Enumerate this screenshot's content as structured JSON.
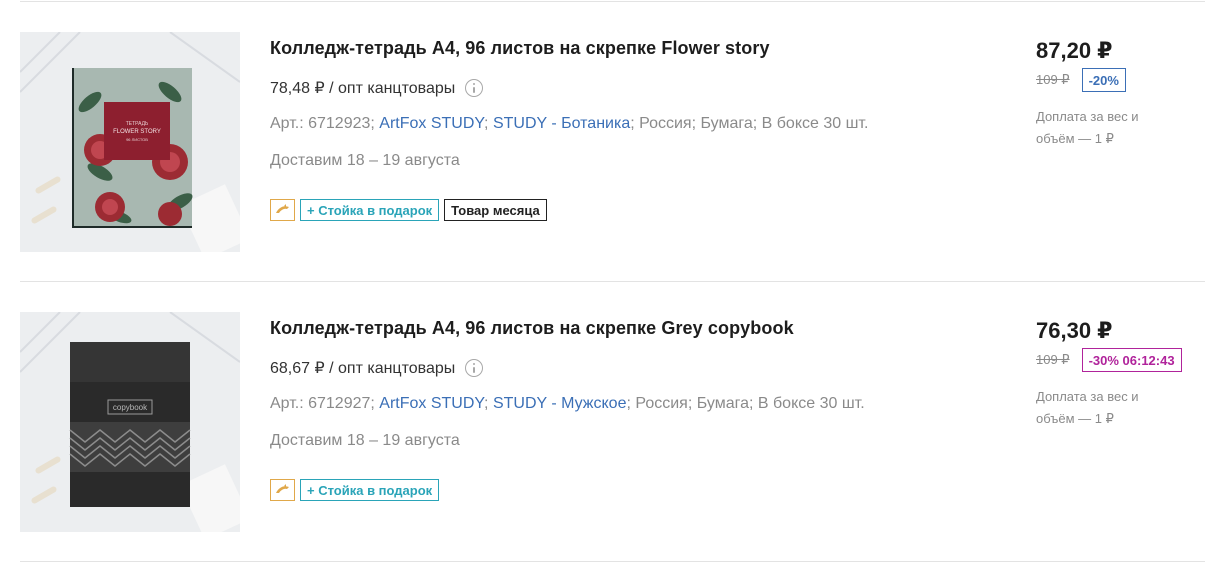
{
  "products": [
    {
      "title": "Колледж-тетрадь А4, 96 листов на скрепке Flower story",
      "wholesale_price": "78,48 ₽ / опт канцтовары",
      "art_label": "Арт.: 6712923;",
      "brand": "ArtFox STUDY",
      "series": "STUDY - Ботаника",
      "country": "Россия;",
      "material": "Бумага;",
      "box": "В боксе 30 шт.",
      "delivery": "Доставим 18 – 19 августа",
      "gift_tag": "+ Стойка в подарок",
      "month_tag": "Товар месяца",
      "price": "87,20 ₽",
      "old_price": "109 ₽",
      "discount": "-20%",
      "surcharge": "Доплата за вес и объём — 1 ₽",
      "cover": {
        "label_line1": "ТЕТРАДЬ",
        "label_line2": "FLOWER STORY",
        "label_line3": "96 ЛИСТОВ"
      }
    },
    {
      "title": "Колледж-тетрадь А4, 96 листов на скрепке Grey copybook",
      "wholesale_price": "68,67 ₽ / опт канцтовары",
      "art_label": "Арт.: 6712927;",
      "brand": "ArtFox STUDY",
      "series": "STUDY - Мужское",
      "country": "Россия;",
      "material": "Бумага;",
      "box": "В боксе 30 шт.",
      "delivery": "Доставим 18 – 19 августа",
      "gift_tag": "+ Стойка в подарок",
      "price": "76,30 ₽",
      "old_price": "109 ₽",
      "discount": "-30% 06:12:43",
      "surcharge": "Доплата за вес и объём — 1 ₽",
      "cover": {
        "label": "copybook"
      }
    }
  ],
  "colors": {
    "link": "#3b6fb6",
    "gift": "#2aa4b8",
    "discount_blue": "#3b6fb6",
    "discount_timer": "#b0239b",
    "promo_icon": "#e0a84a"
  },
  "icons": {
    "info": "info-circle-icon",
    "promo": "dolphin-icon"
  }
}
